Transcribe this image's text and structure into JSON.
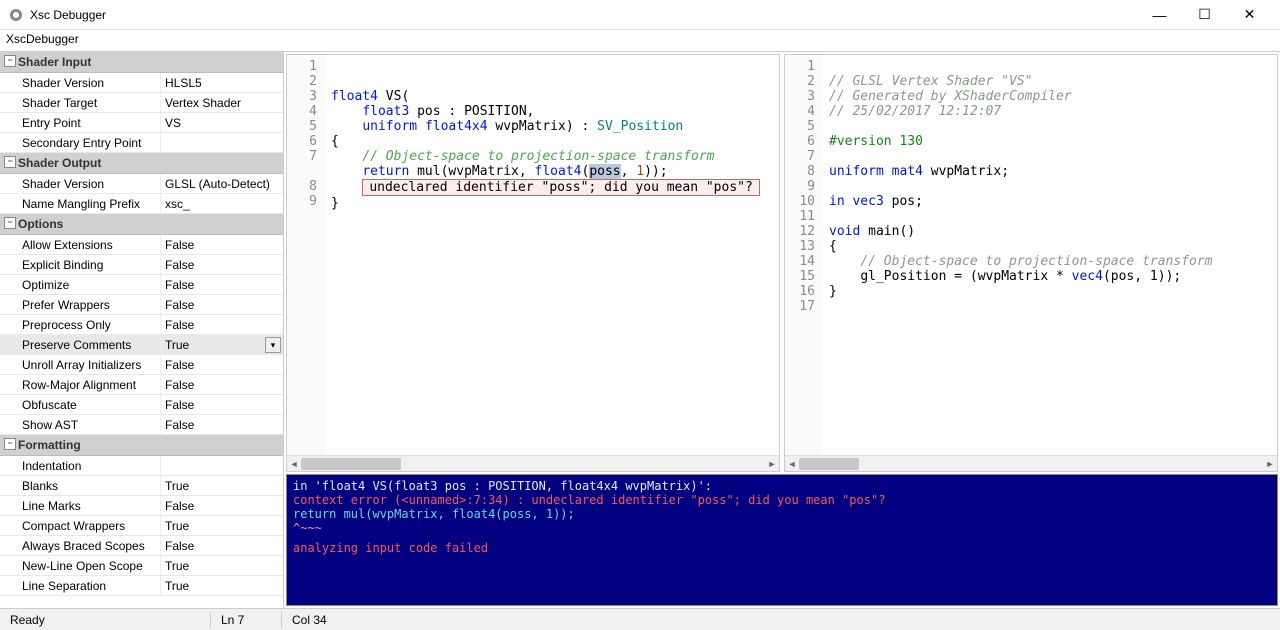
{
  "window": {
    "title": "Xsc Debugger",
    "menu": "XscDebugger"
  },
  "sidebar": {
    "groups": [
      {
        "title": "Shader Input",
        "rows": [
          {
            "label": "Shader Version",
            "value": "HLSL5"
          },
          {
            "label": "Shader Target",
            "value": "Vertex Shader"
          },
          {
            "label": "Entry Point",
            "value": "VS"
          },
          {
            "label": "Secondary Entry Point",
            "value": ""
          }
        ]
      },
      {
        "title": "Shader Output",
        "rows": [
          {
            "label": "Shader Version",
            "value": "GLSL (Auto-Detect)"
          },
          {
            "label": "Name Mangling Prefix",
            "value": "xsc_"
          }
        ]
      },
      {
        "title": "Options",
        "rows": [
          {
            "label": "Allow Extensions",
            "value": "False"
          },
          {
            "label": "Explicit Binding",
            "value": "False"
          },
          {
            "label": "Optimize",
            "value": "False"
          },
          {
            "label": "Prefer Wrappers",
            "value": "False"
          },
          {
            "label": "Preprocess Only",
            "value": "False"
          },
          {
            "label": "Preserve Comments",
            "value": "True",
            "selected": true,
            "dropdown": true
          },
          {
            "label": "Unroll Array Initializers",
            "value": "False"
          },
          {
            "label": "Row-Major Alignment",
            "value": "False"
          },
          {
            "label": "Obfuscate",
            "value": "False"
          },
          {
            "label": "Show AST",
            "value": "False"
          }
        ]
      },
      {
        "title": "Formatting",
        "rows": [
          {
            "label": "Indentation",
            "value": ""
          },
          {
            "label": "Blanks",
            "value": "True"
          },
          {
            "label": "Line Marks",
            "value": "False"
          },
          {
            "label": "Compact Wrappers",
            "value": "True"
          },
          {
            "label": "Always Braced Scopes",
            "value": "False"
          },
          {
            "label": "New-Line Open Scope",
            "value": "True"
          },
          {
            "label": "Line Separation",
            "value": "True"
          }
        ]
      }
    ]
  },
  "leftEditor": {
    "lines": [
      "1",
      "2",
      "3",
      "4",
      "5",
      "6",
      "7",
      "",
      "8",
      "9"
    ],
    "tok": {
      "l2a": "float4",
      "l2b": " VS(",
      "l3a": "float3",
      "l3b": " pos : POSITION,",
      "l4a": "uniform ",
      "l4b": "float4x4",
      "l4c": " wvpMatrix) : ",
      "l4d": "SV_Position",
      "l5": "{",
      "l6": "// Object-space to projection-space transform",
      "l7a": "return",
      "l7b": " mul(wvpMatrix, ",
      "l7c": "float4",
      "l7d": "(",
      "l7e": "poss",
      "l7f": ", ",
      "l7g": "1",
      "l7h": "));",
      "err": "undeclared identifier \"poss\"; did you mean \"pos\"?",
      "l8": "}"
    }
  },
  "rightEditor": {
    "lines": [
      "1",
      "2",
      "3",
      "4",
      "5",
      "6",
      "7",
      "8",
      "9",
      "10",
      "11",
      "12",
      "13",
      "14",
      "15",
      "16",
      "17"
    ],
    "tok": {
      "l1": "// GLSL Vertex Shader \"VS\"",
      "l2": "// Generated by XShaderCompiler",
      "l3": "// 25/02/2017 12:12:07",
      "l5": "#version 130",
      "l7a": "uniform ",
      "l7b": "mat4",
      "l7c": " wvpMatrix;",
      "l9a": "in ",
      "l9b": "vec3",
      "l9c": " pos;",
      "l11a": "void",
      "l11b": " main()",
      "l12": "{",
      "l13": "// Object-space to projection-space transform",
      "l14a": "gl_Position = (wvpMatrix * ",
      "l14b": "vec4",
      "l14c": "(pos, ",
      "l14d": "1",
      "l14e": "));",
      "l15": "}"
    }
  },
  "console": {
    "l1": "in 'float4 VS(float3 pos : POSITION, float4x4 wvpMatrix)':",
    "l2": "context error (<unnamed>:7:34) : undeclared identifier \"poss\"; did you mean \"pos\"?",
    "l3": "    return mul(wvpMatrix, float4(poss, 1));",
    "l4": "                                 ^~~~",
    "l5": "analyzing input code failed"
  },
  "status": {
    "ready": "Ready",
    "line": "Ln 7",
    "col": "Col 34"
  }
}
